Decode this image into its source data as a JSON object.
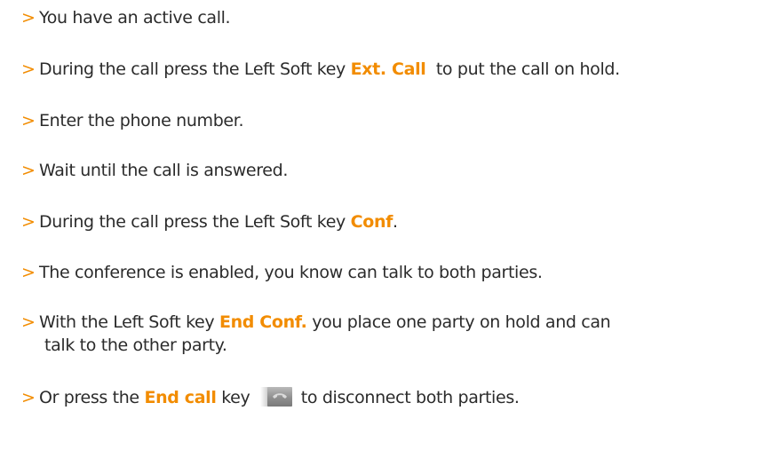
{
  "bullet_glyph": ">",
  "accent_color": "#f28c00",
  "steps": [
    {
      "text": "You have an active call."
    },
    {
      "pre": "During the call press the Left Soft key ",
      "hl": "Ext. Call",
      "post": "  to put the call on hold."
    },
    {
      "text": "Enter the phone number."
    },
    {
      "text": "Wait until the call is answered."
    },
    {
      "pre": "During the call press the Left Soft key ",
      "hl": "Conf",
      "post": "."
    },
    {
      "text": "The conference is enabled, you know can talk to both parties."
    },
    {
      "pre": "With the Left Soft key ",
      "hl": "End Conf.",
      "post": " you place one party on hold and can",
      "cont": "talk to the other party."
    },
    {
      "pre": "Or press the ",
      "hl": "End call",
      "mid": " key ",
      "icon": "end-call-key-icon",
      "post": " to disconnect both parties."
    }
  ]
}
